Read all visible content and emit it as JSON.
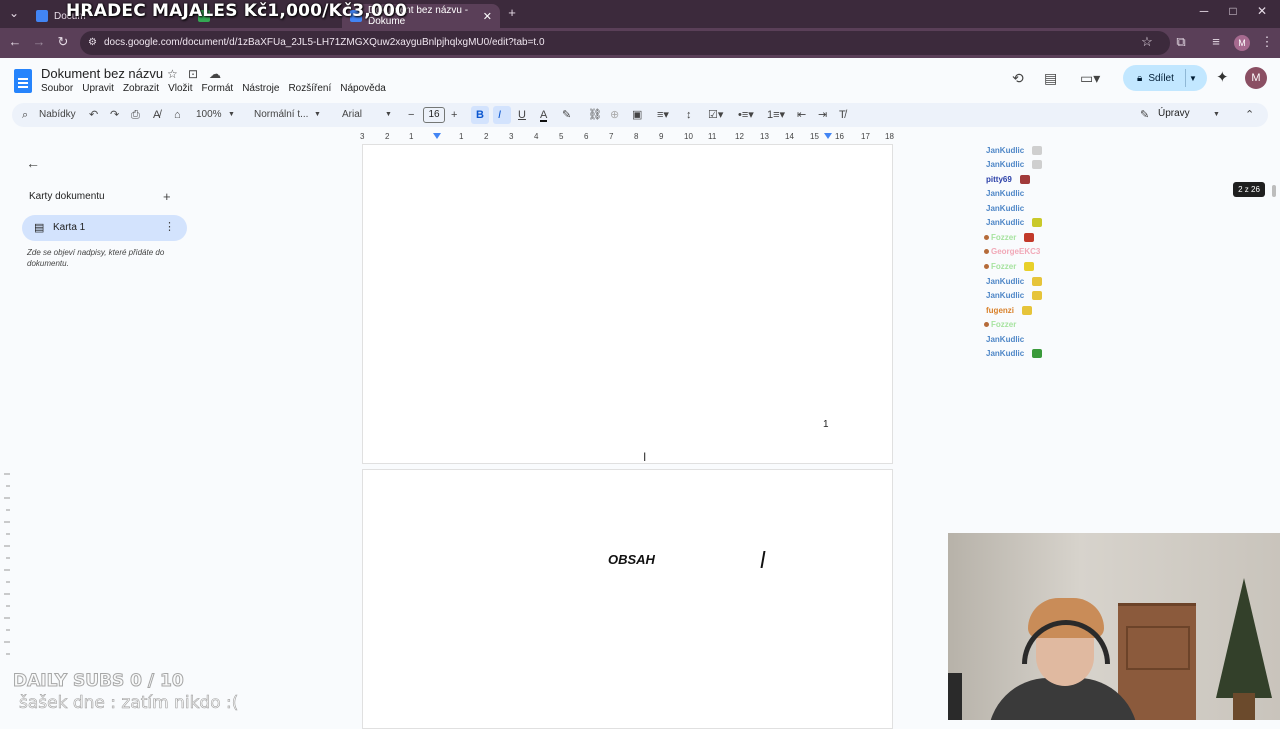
{
  "overlay_title": "HRADEC MAJALES Kč1,000/Kč3,000",
  "browser": {
    "tabs": [
      {
        "label": "Docum"
      },
      {
        "label": ""
      },
      {
        "label": "Dokument bez názvu - Dokume"
      }
    ],
    "new_tab": "+",
    "url": "docs.google.com/document/d/1zBaXFUa_2JL5-LH71ZMGXQuw2xayguBnlpjhqlxgMU0/edit?tab=t.0",
    "profile_initial": "M",
    "window_controls": {
      "minimize": "─",
      "maximize": "□",
      "close": "✕"
    }
  },
  "docs": {
    "title": "Dokument bez názvu",
    "menu": [
      "Soubor",
      "Upravit",
      "Zobrazit",
      "Vložit",
      "Formát",
      "Nástroje",
      "Rozšíření",
      "Nápověda"
    ],
    "share_label": "Sdílet",
    "avatar_initial": "M",
    "toolbar": {
      "search_label": "Nabídky",
      "zoom": "100%",
      "style": "Normální t...",
      "font": "Arial",
      "font_size": "16",
      "mode": "Úpravy"
    },
    "ruler_ticks": [
      "3",
      "2",
      "1",
      "1",
      "2",
      "3",
      "4",
      "5",
      "6",
      "7",
      "8",
      "9",
      "10",
      "11",
      "12",
      "13",
      "14",
      "15",
      "16",
      "17",
      "18"
    ]
  },
  "sidebar": {
    "heading": "Karty dokumentu",
    "tab_label": "Karta 1",
    "note": "Zde se objeví nadpisy, které přidáte do dokumentu."
  },
  "document": {
    "page_number": "1",
    "page2_text": "OBSAH"
  },
  "chat": {
    "messages": [
      {
        "user": "JanKudlic",
        "color": "#4f87c7",
        "msg": "",
        "emote_color": "#cfcfcf"
      },
      {
        "user": "JanKudlic",
        "color": "#4f87c7",
        "msg": "",
        "emote_color": "#cfcfcf"
      },
      {
        "user": "pitty69",
        "color": "#2a3fa8",
        "msg": "",
        "emote_color": "#a13a3a"
      },
      {
        "user": "JanKudlic",
        "color": "#4f87c7",
        "msg": "",
        "emote_color": ""
      },
      {
        "user": "JanKudlic",
        "color": "#4f87c7",
        "msg": "",
        "emote_color": ""
      },
      {
        "user": "JanKudlic",
        "color": "#4f87c7",
        "msg": "",
        "emote_color": "#c9c92a"
      },
      {
        "user": "Fozzer",
        "color": "#a7e3a0",
        "msg": "",
        "emote_color": "#c23a2a"
      },
      {
        "user": "GeorgeEKC3",
        "color": "#f1a9b8",
        "msg": "",
        "emote_color": ""
      },
      {
        "user": "Fozzer",
        "color": "#a7e3a0",
        "msg": "",
        "emote_color": "#e8d02a"
      },
      {
        "user": "JanKudlic",
        "color": "#4f87c7",
        "msg": "",
        "emote_color": "#e6c43a"
      },
      {
        "user": "JanKudlic",
        "color": "#4f87c7",
        "msg": "",
        "emote_color": "#e6c43a"
      },
      {
        "user": "fugenzi",
        "color": "#d9812a",
        "msg": "",
        "emote_color": "#e6c43a"
      },
      {
        "user": "Fozzer",
        "color": "#a7e3a0",
        "msg": "",
        "emote_color": ""
      },
      {
        "user": "JanKudlic",
        "color": "#4f87c7",
        "msg": "",
        "emote_color": ""
      },
      {
        "user": "JanKudlic",
        "color": "#4f87c7",
        "msg": "",
        "emote_color": "#3a9a3a"
      }
    ]
  },
  "page_badge": "2 z 26",
  "stream_overlay": {
    "daily_subs": "DAILY SUBS 0 / 10",
    "sasek": "šašek dne : zatím nikdo :("
  }
}
